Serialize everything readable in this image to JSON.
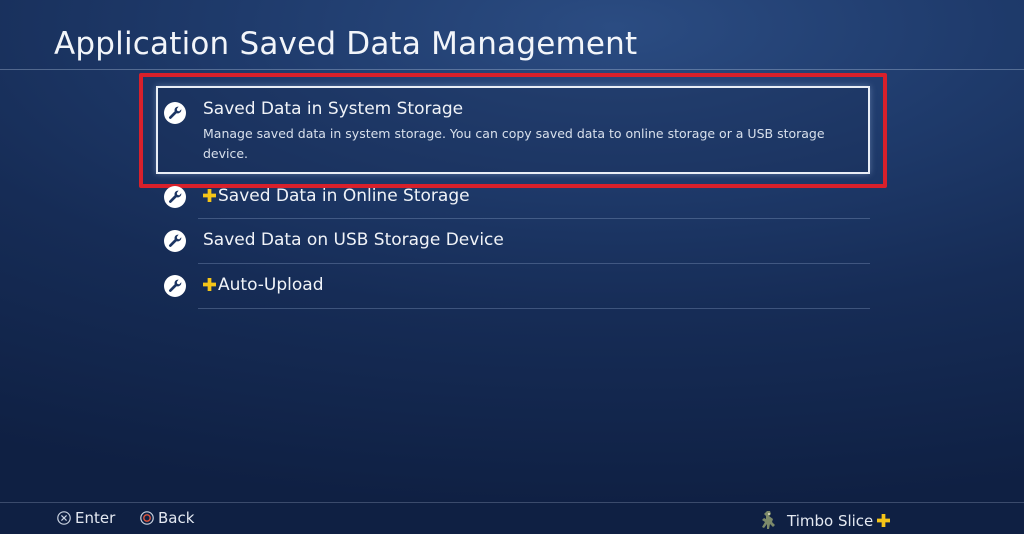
{
  "header": {
    "title": "Application Saved Data Management"
  },
  "menu": {
    "items": [
      {
        "label": "Saved Data in System Storage",
        "description": "Manage saved data in system storage. You can copy saved data to online storage or a USB storage device.",
        "icon": "wrench-icon",
        "plus_badge": false,
        "selected": true
      },
      {
        "label": "Saved Data in Online Storage",
        "icon": "wrench-icon",
        "plus_badge": true,
        "selected": false
      },
      {
        "label": "Saved Data on USB Storage Device",
        "icon": "wrench-icon",
        "plus_badge": false,
        "selected": false
      },
      {
        "label": "Auto-Upload",
        "icon": "wrench-icon",
        "plus_badge": true,
        "selected": false
      }
    ]
  },
  "footer": {
    "enter_label": "Enter",
    "back_label": "Back",
    "username": "Timbo Slice",
    "enter_icon": "cross-button-icon",
    "back_icon": "circle-button-icon",
    "user_plus_icon": "ps-plus-icon"
  },
  "colors": {
    "highlight_border": "#d8202b",
    "plus_yellow": "#f5c518",
    "background": "#1f3b6c"
  }
}
